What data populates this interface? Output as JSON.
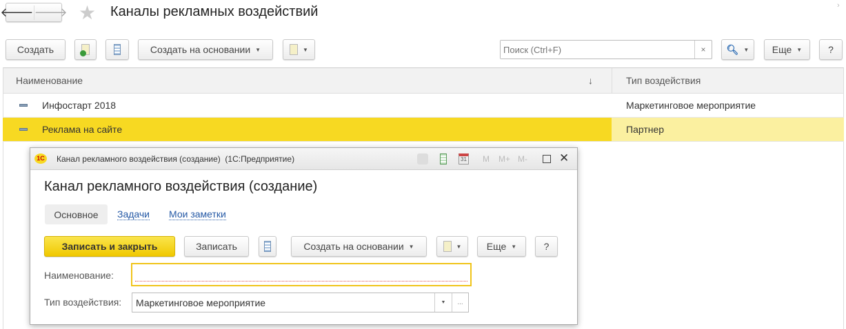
{
  "header": {
    "title": "Каналы рекламных воздействий"
  },
  "toolbar": {
    "create": "Создать",
    "create_based": "Создать на основании",
    "search_placeholder": "Поиск (Ctrl+F)",
    "search_clear": "×",
    "more": "Еще",
    "help": "?"
  },
  "table": {
    "columns": [
      "Наименование",
      "Тип воздействия"
    ],
    "sort_indicator": "↓",
    "rows": [
      {
        "name": "Инфостарт 2018",
        "type": "Маркетинговое мероприятие"
      },
      {
        "name": "Реклама на сайте",
        "type": "Партнер"
      }
    ]
  },
  "dialog": {
    "window_title": "Канал рекламного воздействия (создание)  (1С:Предприятие)",
    "logo": "1С",
    "title": "Канал рекламного воздействия (создание)",
    "titlebar_buttons": [
      "M",
      "M+",
      "M-"
    ],
    "calendar_day": "31",
    "tabs": [
      "Основное",
      "Задачи",
      "Мои заметки"
    ],
    "buttons": {
      "save_close": "Записать и закрыть",
      "save": "Записать",
      "create_based": "Создать на основании",
      "more": "Еще",
      "help": "?"
    },
    "fields": {
      "name_label": "Наименование:",
      "name_value": "",
      "type_label": "Тип воздействия:",
      "type_value": "Маркетинговое мероприятие",
      "choose": "..."
    }
  },
  "colors": {
    "accent": "#f7d922",
    "row_light": "#fbf0a0"
  }
}
